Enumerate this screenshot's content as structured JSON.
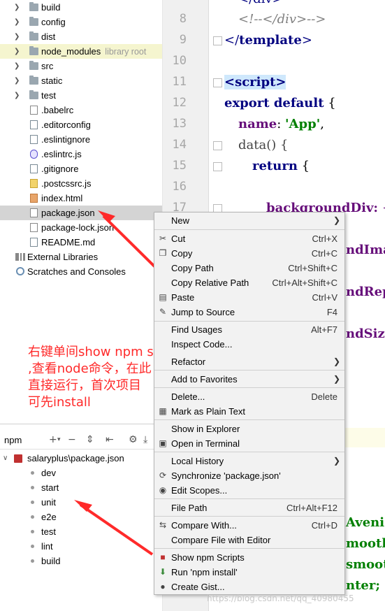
{
  "project_tree": {
    "items": [
      {
        "label": "build",
        "kind": "folder"
      },
      {
        "label": "config",
        "kind": "folder"
      },
      {
        "label": "dist",
        "kind": "folder"
      },
      {
        "label": "node_modules",
        "hint": "library root",
        "kind": "folder"
      },
      {
        "label": "src",
        "kind": "folder"
      },
      {
        "label": "static",
        "kind": "folder"
      },
      {
        "label": "test",
        "kind": "folder"
      },
      {
        "label": ".babelrc",
        "kind": "json"
      },
      {
        "label": ".editorconfig",
        "kind": "file"
      },
      {
        "label": ".eslintignore",
        "kind": "file"
      },
      {
        "label": ".eslintrc.js",
        "kind": "eslint"
      },
      {
        "label": ".gitignore",
        "kind": "file"
      },
      {
        "label": ".postcssrc.js",
        "kind": "js"
      },
      {
        "label": "index.html",
        "kind": "html"
      },
      {
        "label": "package.json",
        "kind": "json"
      },
      {
        "label": "package-lock.json",
        "kind": "json"
      },
      {
        "label": "README.md",
        "kind": "file"
      }
    ],
    "external_libraries": "External Libraries",
    "scratches": "Scratches and Consoles"
  },
  "editor": {
    "line_numbers": [
      "8",
      "9",
      "10",
      "11",
      "12",
      "13",
      "14",
      "15",
      "16",
      "17"
    ],
    "lines": {
      "l7": "</div>",
      "l8": "<!--</div>-->",
      "l9_a": "</",
      "l9_b": "template",
      "l9_c": ">",
      "l11": "<script>",
      "l12_kw": "export default",
      "l12_rest": " {",
      "l13_prop": "name",
      "l13_colon": ": ",
      "l13_str": "'App'",
      "l13_end": ",",
      "l14": "data() {",
      "l15_kw": "return",
      "l15_rest": " {",
      "l17": "backgroundDiv: {",
      "frag_image": "ndImag",
      "frag_repeat": "ndRepe",
      "frag_size": "ndSize",
      "frag_avenir": "Aveni",
      "frag_smooth1": "moothi",
      "frag_smooth2": "smooth",
      "frag_center": "nter;"
    }
  },
  "annotation": {
    "line1": "右键单间show npm scripts",
    "line2": ",查看node命令，在此",
    "line3": "直接运行，首次项目",
    "line4": "可先install"
  },
  "npm_panel": {
    "title": "npm",
    "root": "salaryplus\\package.json",
    "scripts": [
      "dev",
      "start",
      "unit",
      "e2e",
      "test",
      "lint",
      "build"
    ]
  },
  "context_menu": {
    "new": "New",
    "cut": "Cut",
    "cut_sc": "Ctrl+X",
    "copy": "Copy",
    "copy_sc": "Ctrl+C",
    "copy_path": "Copy Path",
    "copy_path_sc": "Ctrl+Shift+C",
    "copy_rel": "Copy Relative Path",
    "copy_rel_sc": "Ctrl+Alt+Shift+C",
    "paste": "Paste",
    "paste_sc": "Ctrl+V",
    "jump": "Jump to Source",
    "jump_sc": "F4",
    "find_usages": "Find Usages",
    "find_usages_sc": "Alt+F7",
    "inspect": "Inspect Code...",
    "refactor": "Refactor",
    "favorites": "Add to Favorites",
    "delete": "Delete...",
    "delete_sc": "Delete",
    "plain_text": "Mark as Plain Text",
    "explorer": "Show in Explorer",
    "terminal": "Open in Terminal",
    "local_history": "Local History",
    "sync": "Synchronize 'package.json'",
    "edit_scopes": "Edit Scopes...",
    "file_path": "File Path",
    "file_path_sc": "Ctrl+Alt+F12",
    "compare_with": "Compare With...",
    "compare_with_sc": "Ctrl+D",
    "compare_file": "Compare File with Editor",
    "show_npm": "Show npm Scripts",
    "run_npm": "Run 'npm install'",
    "gist": "Create Gist..."
  },
  "watermark": "https://blog.csdn.net/qq_40980455",
  "colors": {
    "annotation_red": "#ff2a2a",
    "menu_bg": "#f2f2f2",
    "selection": "#d4d4d4",
    "library_highlight": "#f5f5cf"
  }
}
